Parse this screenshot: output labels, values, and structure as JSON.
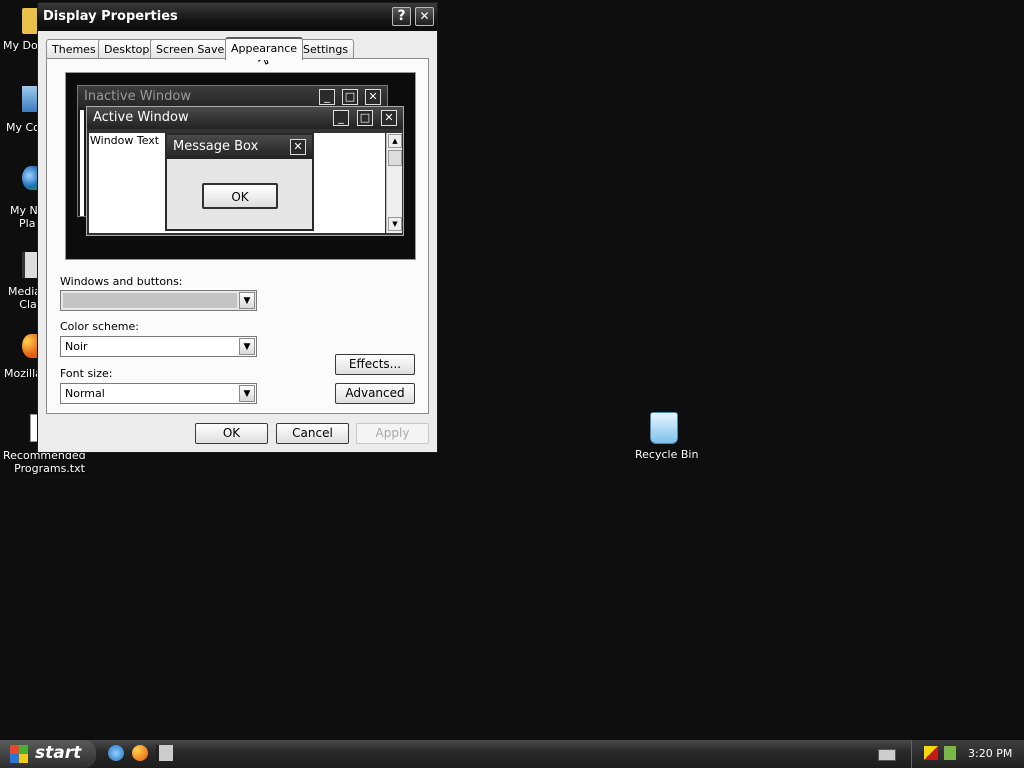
{
  "desktop": {
    "icons": [
      {
        "label": "My Doc",
        "icon": "folder-icon"
      },
      {
        "label": "My Co",
        "icon": "computer-icon"
      },
      {
        "label": "My Ne\nPla",
        "icon": "network-globe-icon"
      },
      {
        "label": "Media\nCla",
        "icon": "media-player-icon"
      },
      {
        "label": "Mozilla",
        "icon": "firefox-icon"
      },
      {
        "label": "Recommended\nPrograms.txt",
        "icon": "text-file-icon"
      },
      {
        "label": "Recycle Bin",
        "icon": "recycle-bin-icon"
      }
    ]
  },
  "dialog": {
    "title": "Display Properties",
    "help_btn": "?",
    "close_btn": "✕",
    "tabs": [
      "Themes",
      "Desktop",
      "Screen Saver",
      "Appearance",
      "Settings"
    ],
    "active_tab": "Appearance",
    "preview": {
      "inactive_title": "Inactive Window",
      "active_title": "Active Window",
      "window_text": "Window Text",
      "message_title": "Message Box",
      "message_ok": "OK"
    },
    "windows_buttons_label": "Windows and buttons:",
    "windows_buttons_value": "",
    "color_scheme_label": "Color scheme:",
    "color_scheme_value": "Noir",
    "font_size_label": "Font size:",
    "font_size_value": "Normal",
    "effects_btn": "Effects...",
    "advanced_btn": "Advanced",
    "ok_btn": "OK",
    "cancel_btn": "Cancel",
    "apply_btn": "Apply"
  },
  "taskbar": {
    "start_label": "start",
    "quicklaunch": [
      "internet-explorer-icon",
      "firefox-icon",
      "media-icon"
    ],
    "clock": "3:20 PM"
  },
  "colors": {
    "desktop_bg": "#0e0e0e",
    "titlebar": "#151515",
    "dialog_bg": "#ececec"
  }
}
